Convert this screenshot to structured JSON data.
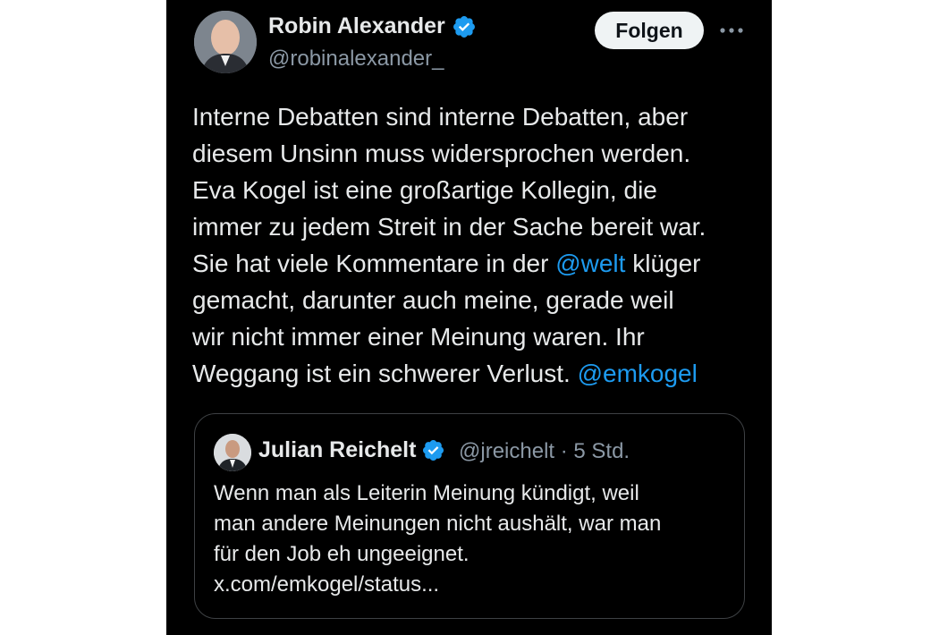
{
  "tweet": {
    "author": {
      "name": "Robin Alexander",
      "handle": "@robinalexander_",
      "verified": true
    },
    "follow_label": "Folgen",
    "more_icon": "more-horizontal-icon",
    "body": {
      "line1": "Interne Debatten sind interne Debatten, aber",
      "line2": "diesem Unsinn muss widersprochen werden.",
      "line3": "Eva Kogel ist eine großartige Kollegin, die",
      "line4": "immer zu jedem Streit in der Sache bereit war.",
      "line5_pre": "Sie hat viele Kommentare in der ",
      "line5_mention": "@welt",
      "line5_post": " klüger",
      "line6": "gemacht, darunter auch meine, gerade weil",
      "line7": "wir nicht immer einer Meinung waren. Ihr",
      "line8_pre": "Weggang ist ein schwerer Verlust. ",
      "line8_mention": "@emkogel"
    }
  },
  "quoted": {
    "author": {
      "name": "Julian Reichelt",
      "handle": "@jreichelt",
      "verified": true
    },
    "meta": "@jreichelt · 5 Std.",
    "text": {
      "line1": "Wenn man als Leiterin Meinung kündigt, weil",
      "line2": "man andere Meinungen nicht aushält, war man",
      "line3": "für den Job eh ungeeignet.",
      "line4": "x.com/emkogel/status..."
    }
  },
  "colors": {
    "background": "#000000",
    "text": "#e7e9ea",
    "secondary": "#8b98a5",
    "link": "#1d9bf0",
    "verified": "#1d9bf0"
  }
}
